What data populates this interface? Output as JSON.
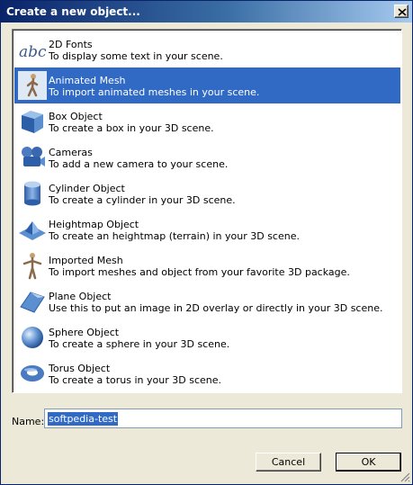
{
  "window": {
    "title": "Create a new object..."
  },
  "items": [
    {
      "name": "2D Fonts",
      "desc": "To display some text in your scene.",
      "icon": "text-abc-icon"
    },
    {
      "name": "Animated Mesh",
      "desc": "To import animated meshes in your scene.",
      "icon": "walking-figure-icon",
      "selected": true
    },
    {
      "name": "Box Object",
      "desc": "To create a box in your 3D scene.",
      "icon": "box-icon"
    },
    {
      "name": "Cameras",
      "desc": "To add a new camera to your scene.",
      "icon": "camera-icon"
    },
    {
      "name": "Cylinder Object",
      "desc": "To create a cylinder in your 3D scene.",
      "icon": "cylinder-icon"
    },
    {
      "name": "Heightmap Object",
      "desc": "To create an heightmap (terrain) in your 3D scene.",
      "icon": "terrain-icon"
    },
    {
      "name": "Imported Mesh",
      "desc": "To import meshes and object from your favorite 3D package.",
      "icon": "figure-icon"
    },
    {
      "name": "Plane Object",
      "desc": "Use this to put an image in 2D overlay or directly in your 3D scene.",
      "icon": "plane-icon"
    },
    {
      "name": "Sphere Object",
      "desc": "To create a sphere in your 3D scene.",
      "icon": "sphere-icon"
    },
    {
      "name": "Torus Object",
      "desc": "To create a torus in your 3D scene.",
      "icon": "torus-icon"
    }
  ],
  "name_field": {
    "label": "Name:",
    "value": "softpedia-test"
  },
  "buttons": {
    "cancel": "Cancel",
    "ok": "OK"
  },
  "colors": {
    "selection": "#316ac5",
    "titlebar": "#0a246a",
    "face": "#ece9d8"
  }
}
